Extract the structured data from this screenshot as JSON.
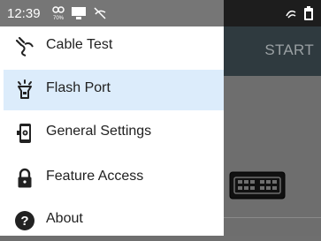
{
  "status_bar": {
    "time": "12:39",
    "icons": [
      "sync-percent-icon",
      "cast-icon",
      "signal-off-icon",
      "signal-icon",
      "battery-icon"
    ]
  },
  "app_bar": {
    "action_label": "START"
  },
  "drawer": {
    "items": [
      {
        "label": "Cable Test",
        "icon": "cable-icon",
        "selected": false
      },
      {
        "label": "Flash Port",
        "icon": "flash-port-icon",
        "selected": true
      },
      {
        "label": "General Settings",
        "icon": "phone-settings-icon",
        "selected": false
      },
      {
        "label": "Feature Access",
        "icon": "lock-icon",
        "selected": false
      },
      {
        "label": "About",
        "icon": "help-icon",
        "selected": false
      }
    ]
  },
  "colors": {
    "selected_background": "#dcecfb",
    "app_bar": "#2f3a3f",
    "status_bar": "#767676"
  }
}
